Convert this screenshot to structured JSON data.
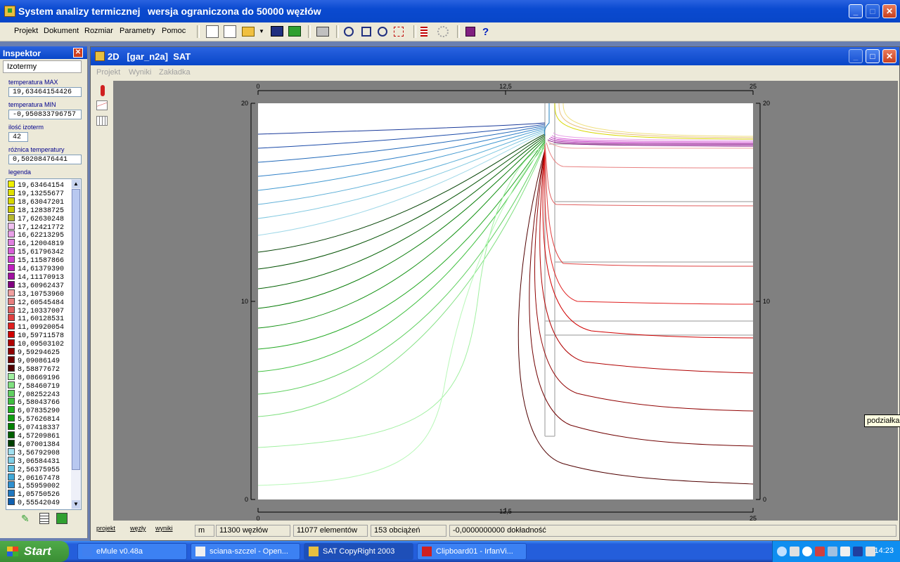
{
  "app": {
    "title_name": "System analizy termicznej",
    "title_edition": "wersja ograniczona do 50000 węzłów"
  },
  "menu": [
    "Projekt",
    "Dokument",
    "Rozmiar",
    "Parametry",
    "Pomoc"
  ],
  "toolbar_icons": [
    "new-doc-icon",
    "new-doc2-icon",
    "open-folder-icon",
    "dropdown-arrow-icon",
    "save-icon",
    "export-icon",
    "print-icon",
    "zoom-in-icon",
    "zoom-fit-icon",
    "zoom-out-icon",
    "select-rect-icon",
    "list-icon",
    "settings-icon",
    "book-icon",
    "help-icon"
  ],
  "inspector": {
    "title": "Inspektor",
    "close": "✕",
    "tab": "Izotermy",
    "temp_max_label": "temperatura MAX",
    "temp_max_value": "19,63464154426",
    "temp_min_label": "temperatura MIN",
    "temp_min_value": "-0,950833796757",
    "count_label": "ilość izoterm",
    "count_value": "42",
    "diff_label": "różnica temperatury",
    "diff_value": "0,50208476441",
    "legend_label": "legenda",
    "legend": [
      {
        "v": "19,63464154",
        "c": "#f0f000"
      },
      {
        "v": "19,13255677",
        "c": "#e0e000"
      },
      {
        "v": "18,63047201",
        "c": "#d8d800"
      },
      {
        "v": "18,12838725",
        "c": "#c8c800"
      },
      {
        "v": "17,62630248",
        "c": "#b8b830"
      },
      {
        "v": "17,12421772",
        "c": "#f0c0f0"
      },
      {
        "v": "16,62213295",
        "c": "#e8a0e8"
      },
      {
        "v": "16,12004819",
        "c": "#e080e0"
      },
      {
        "v": "15,61796342",
        "c": "#d860d8"
      },
      {
        "v": "15,11587866",
        "c": "#d040d0"
      },
      {
        "v": "14,61379390",
        "c": "#c020c0"
      },
      {
        "v": "14,11170913",
        "c": "#a010a0"
      },
      {
        "v": "13,60962437",
        "c": "#800080"
      },
      {
        "v": "13,10753960",
        "c": "#f0a0a0"
      },
      {
        "v": "12,60545484",
        "c": "#e88080"
      },
      {
        "v": "12,10337007",
        "c": "#e06060"
      },
      {
        "v": "11,60128531",
        "c": "#e04040"
      },
      {
        "v": "11,09920054",
        "c": "#e02020"
      },
      {
        "v": "10,59711578",
        "c": "#d00000"
      },
      {
        "v": "10,09503102",
        "c": "#b00000"
      },
      {
        "v": "9,59294625",
        "c": "#900000"
      },
      {
        "v": "9,09086149",
        "c": "#700000"
      },
      {
        "v": "8,58877672",
        "c": "#500000"
      },
      {
        "v": "8,08669196",
        "c": "#a0f0a0"
      },
      {
        "v": "7,58460719",
        "c": "#80e080"
      },
      {
        "v": "7,08252243",
        "c": "#60d060"
      },
      {
        "v": "6,58043766",
        "c": "#40c040"
      },
      {
        "v": "6,07835290",
        "c": "#20b020"
      },
      {
        "v": "5,57626814",
        "c": "#10a010"
      },
      {
        "v": "5,07418337",
        "c": "#008000"
      },
      {
        "v": "4,57209861",
        "c": "#006000"
      },
      {
        "v": "4,07001384",
        "c": "#004000"
      },
      {
        "v": "3,56792908",
        "c": "#a0e0f0"
      },
      {
        "v": "3,06584431",
        "c": "#80d0e8"
      },
      {
        "v": "2,56375955",
        "c": "#60c0e0"
      },
      {
        "v": "2,06167478",
        "c": "#40a8d8"
      },
      {
        "v": "1,55959002",
        "c": "#3090d0"
      },
      {
        "v": "1,05750526",
        "c": "#2078c0"
      },
      {
        "v": "0,55542049",
        "c": "#1060b0"
      }
    ]
  },
  "doc": {
    "title": "2D   [gar_n2a]  SAT",
    "menu": [
      "Projekt",
      "Wyniki",
      "Zakładka"
    ]
  },
  "axes": {
    "x_ticks": [
      "0",
      "12,5",
      "25"
    ],
    "y_ticks": [
      "20",
      "10",
      "0"
    ]
  },
  "status": {
    "tabs": [
      "projekt",
      "węzły",
      "wyniki"
    ],
    "unit": "m",
    "nodes": "11300 węzłów",
    "elements": "11077 elementów",
    "loads": "153 obciążeń",
    "accuracy": "-0,0000000000 dokładność"
  },
  "tooltip": "podziałka",
  "taskbar": {
    "start": "Start",
    "items": [
      "eMule v0.48a",
      "sciana-szczel - Open...",
      "SAT CopyRight 2003",
      "Clipboard01 - IrfanVi..."
    ],
    "clock": "14:23"
  }
}
